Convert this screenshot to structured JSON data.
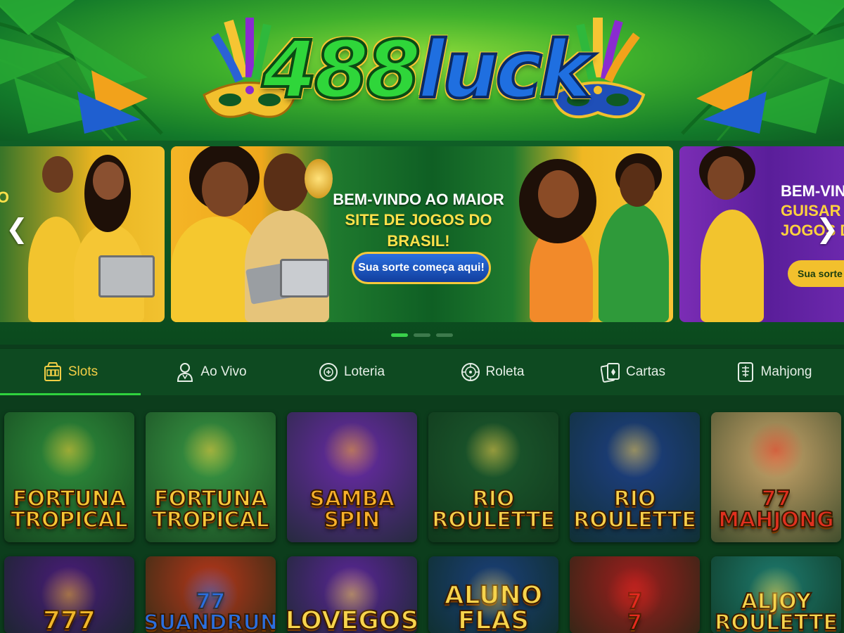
{
  "header": {
    "logo_num": "488",
    "logo_word": "luck"
  },
  "carousel": {
    "prev_slide_text": "UO",
    "main_slide": {
      "line1": "BEM-VINDO AO MAIOR",
      "line2": "SITE DE JOGOS DO BRASIL!",
      "cta": "Sua sorte começa aqui!"
    },
    "next_slide": {
      "line1": "BEM-VINDO",
      "line2": "GUISAR M",
      "line3": "JOGOS DO",
      "cta": "Sua sorte c"
    },
    "prev_arrow": "❮",
    "next_arrow": "❯",
    "active_dot": 0,
    "dot_count": 3
  },
  "tabs": [
    {
      "label": "Slots",
      "icon": "slot-machine-icon",
      "active": true
    },
    {
      "label": "Ao Vivo",
      "icon": "live-dealer-icon",
      "active": false
    },
    {
      "label": "Loteria",
      "icon": "lottery-ball-icon",
      "active": false
    },
    {
      "label": "Roleta",
      "icon": "roulette-wheel-icon",
      "active": false
    },
    {
      "label": "Cartas",
      "icon": "cards-icon",
      "active": false
    },
    {
      "label": "Mahjong",
      "icon": "mahjong-tile-icon",
      "active": false
    }
  ],
  "games": [
    {
      "title": "FORTUNA\nTROPICAL",
      "bg": "#2f8f3c",
      "text_color": "#f6c533"
    },
    {
      "title": "FORTUNA\nTROPICAL",
      "bg": "#3a9a45",
      "text_color": "#f7c73a"
    },
    {
      "title": "SAMBA\nSPIN",
      "bg": "#6a2aa8",
      "text_color": "#f7b02a"
    },
    {
      "title": "RIO\nROULETTE",
      "bg": "#1c5a2e",
      "text_color": "#f8d04a"
    },
    {
      "title": "RIO\nROULETTE",
      "bg": "#1e3f86",
      "text_color": "#f8d04a"
    },
    {
      "title": "77\nMAHJONG",
      "bg": "#c9a56a",
      "text_color": "#e0301f"
    },
    {
      "title": "777",
      "bg": "#4a1b7a",
      "text_color": "#f1b82a"
    },
    {
      "title": "77\nSUANDRUN",
      "bg": "#b8361a",
      "text_color": "#2a6fe0"
    },
    {
      "title": "LOVEGOS",
      "bg": "#5b2598",
      "text_color": "#f7d44c"
    },
    {
      "title": "ALUNO FLAS",
      "bg": "#1b3f7a",
      "text_color": "#f7d44c"
    },
    {
      "title": "7\n7",
      "bg": "#a01d1d",
      "text_color": "#e52a1f"
    },
    {
      "title": "ALJOY\nROULETTE",
      "bg": "#1e7a6e",
      "text_color": "#f7d44c"
    }
  ],
  "colors": {
    "accent_green": "#2fd23e",
    "active_tab_text": "#f3cf46",
    "tab_bar": "#0e4a21",
    "page_bg": "#0c3d1c"
  }
}
